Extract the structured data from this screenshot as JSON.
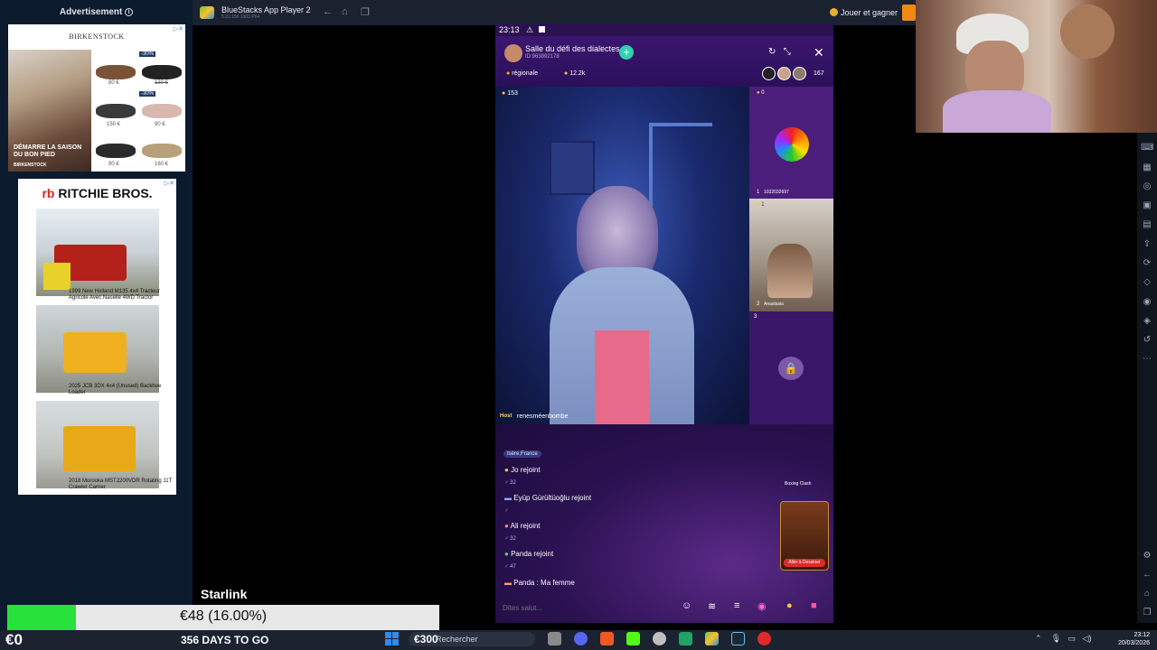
{
  "ads": {
    "header": "Advertisement",
    "birkenstock": {
      "brand": "BIRKENSTOCK",
      "headline": "DÉMARRE LA SAISON DU BON PIED",
      "logo_small": "BIRKENSTOCK",
      "tag1": "-30%",
      "tag2": "-30%",
      "prices": [
        "80 €",
        "130 €",
        "150 €",
        "90 €",
        "90 €",
        "160 €"
      ]
    },
    "ritchie": {
      "logo_rb": "rb",
      "logo_text": "RITCHIE BROS.",
      "items": [
        "1999 New Holland M135 4x4 Tracteur Agricole Avec Nacelle 4WD Tractor",
        "2025 JCB 3DX 4x4 (Unused) Backhoe Loader",
        "2018 Morooka MST2200VDR Rotating 11T Crawler Carrier"
      ]
    }
  },
  "bluestacks": {
    "title": "BlueStacks App Player 2",
    "subtitle": "5.22.156.1003 P64",
    "game_button": "Jouer et gagner"
  },
  "phone": {
    "time": "23:13",
    "room_title": "Salle du défi des dialectes",
    "room_id": "ID:963892178",
    "region": "régionale",
    "coins": "12.2k",
    "viewers": "167",
    "host_badge": "153",
    "host_label": "Host",
    "host_name": "renesméenbombe",
    "slot1_badge": "0",
    "slot1_num": "1",
    "slot1_name": "1032032697",
    "slot2_badge": "1",
    "slot2_num": "2",
    "slot2_name": "Anastasia",
    "slot3_num": "3",
    "chat_region": "Isère,France",
    "chat": [
      {
        "name": "Jo rejoint",
        "sub": "32"
      },
      {
        "name": "Eyüp Gürültüoğlu rejoint",
        "sub": ""
      },
      {
        "name": "Ali rejoint",
        "sub": "32"
      },
      {
        "name": "Panda rejoint",
        "sub": "47"
      },
      {
        "name": "Panda : Ma femme",
        "sub": ""
      }
    ],
    "boxing_clash": "Boxing Clash",
    "game_btn": "Aller à Dessiner",
    "input_placeholder": "Dites salut..."
  },
  "overlay": {
    "starlink": "Starlink",
    "progress_text": "€48 (16.00%)",
    "progress_fraction": 0.16,
    "money": "€0",
    "days": "356 DAYS TO GO",
    "search_overlay": "€300"
  },
  "taskbar": {
    "search_placeholder": "Rechercher",
    "time": "23:12",
    "date": "20/03/2026"
  },
  "colors": {
    "progress_green": "#27e23a",
    "phone_purple": "#2a1150",
    "accent_teal": "#2fd1b0"
  }
}
